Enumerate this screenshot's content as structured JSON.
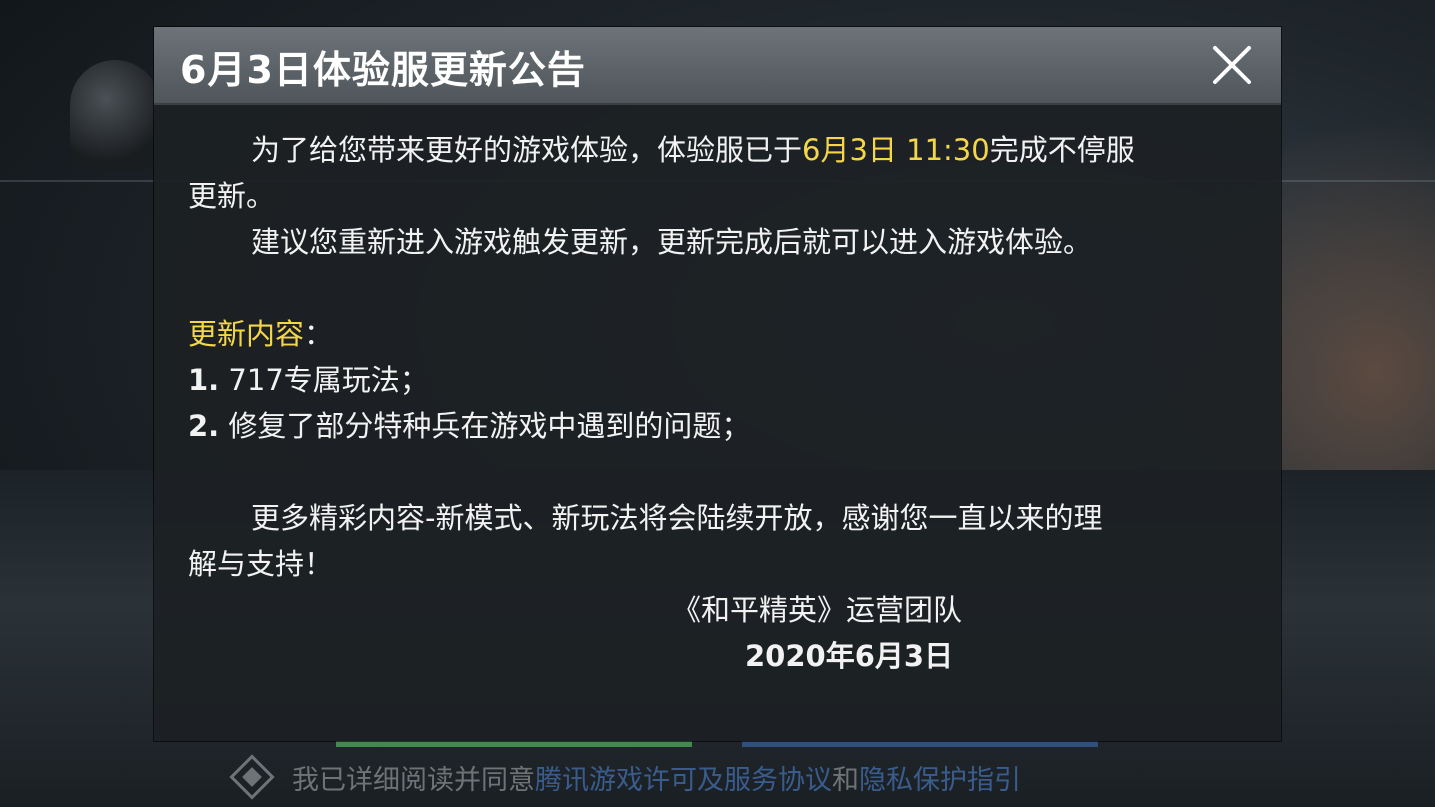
{
  "dialog": {
    "title": "6月3日体验服更新公告",
    "close_icon": "close-icon",
    "para1_prefix": "为了给您带来更好的游戏体验，体验服已于",
    "para1_highlight": "6月3日 11:30",
    "para1_suffix_line1": "完成不停服",
    "para1_suffix_line2": "更新。",
    "para2": "建议您重新进入游戏触发更新，更新完成后就可以进入游戏体验。",
    "update_heading": "更新内容",
    "update_colon": "：",
    "items": [
      {
        "num": "1.",
        "text": " 717专属玩法；"
      },
      {
        "num": "2.",
        "text": " 修复了部分特种兵在游戏中遇到的问题；"
      }
    ],
    "para3_line1": "更多精彩内容-新模式、新玩法将会陆续开放，感谢您一直以来的理",
    "para3_line2": "解与支持！",
    "signature_team": "《和平精英》运营团队",
    "signature_date": "2020年6月3日"
  },
  "agreement": {
    "prefix": "我已详细阅读并同意",
    "link1": "腾讯游戏许可及服务协议",
    "and": "和",
    "link2": "隐私保护指引"
  },
  "colors": {
    "highlight": "#f3d64a",
    "body_text": "#f2f2f2",
    "link": "#3a5c8c"
  }
}
